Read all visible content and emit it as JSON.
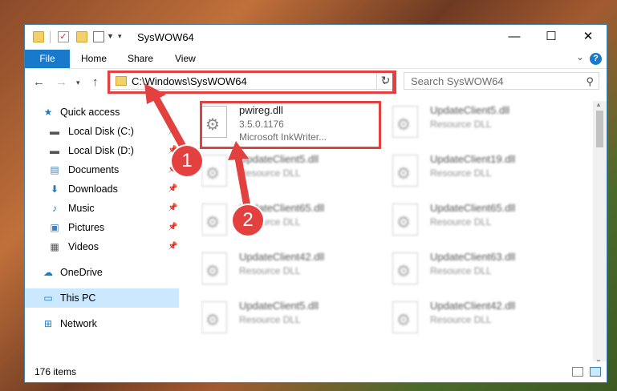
{
  "window": {
    "title": "SysWOW64",
    "minimize_glyph": "—",
    "maximize_glyph": "☐",
    "close_glyph": "✕"
  },
  "ribbon": {
    "tabs": [
      "File",
      "Home",
      "Share",
      "View"
    ],
    "help_glyph": "?"
  },
  "navigation": {
    "address_path": "C:\\Windows\\SysWOW64",
    "search_placeholder": "Search SysWOW64"
  },
  "sidebar": {
    "items": [
      {
        "label": "Quick access",
        "icon": "star-icon",
        "pinned": false
      },
      {
        "label": "Local Disk (C:)",
        "icon": "drive-icon",
        "pinned": true
      },
      {
        "label": "Local Disk (D:)",
        "icon": "drive-icon",
        "pinned": true
      },
      {
        "label": "Documents",
        "icon": "documents-icon",
        "pinned": true
      },
      {
        "label": "Downloads",
        "icon": "downloads-icon",
        "pinned": true
      },
      {
        "label": "Music",
        "icon": "music-icon",
        "pinned": true
      },
      {
        "label": "Pictures",
        "icon": "pictures-icon",
        "pinned": true
      },
      {
        "label": "Videos",
        "icon": "videos-icon",
        "pinned": true
      },
      {
        "label": "OneDrive",
        "icon": "onedrive-icon",
        "pinned": false
      },
      {
        "label": "This PC",
        "icon": "pc-icon",
        "pinned": false,
        "selected": true
      },
      {
        "label": "Network",
        "icon": "network-icon",
        "pinned": false
      }
    ]
  },
  "files": {
    "highlighted": {
      "name": "pwireg.dll",
      "version": "3.5.0.1176",
      "company": "Microsoft InkWriter..."
    },
    "left_column": [
      {
        "name": "UpdateClient5.dll",
        "type": "Resource DLL"
      },
      {
        "name": "UpdateClient65.dll",
        "type": "Resource DLL"
      },
      {
        "name": "UpdateClient42.dll",
        "type": "Resource DLL"
      },
      {
        "name": "UpdateClient5.dll",
        "type": "Resource DLL"
      }
    ],
    "right_column": [
      {
        "name": "UpdateClient5.dll",
        "type": "Resource DLL"
      },
      {
        "name": "UpdateClient19.dll",
        "type": "Resource DLL"
      },
      {
        "name": "UpdateClient65.dll",
        "type": "Resource DLL"
      },
      {
        "name": "UpdateClient63.dll",
        "type": "Resource DLL"
      },
      {
        "name": "UpdateClient42.dll",
        "type": "Resource DLL"
      }
    ]
  },
  "status": {
    "item_count": "176 items"
  },
  "callouts": [
    "1",
    "2"
  ],
  "colors": {
    "accent": "#1979ca",
    "highlight": "#e2413f",
    "selected": "#cce8ff"
  }
}
